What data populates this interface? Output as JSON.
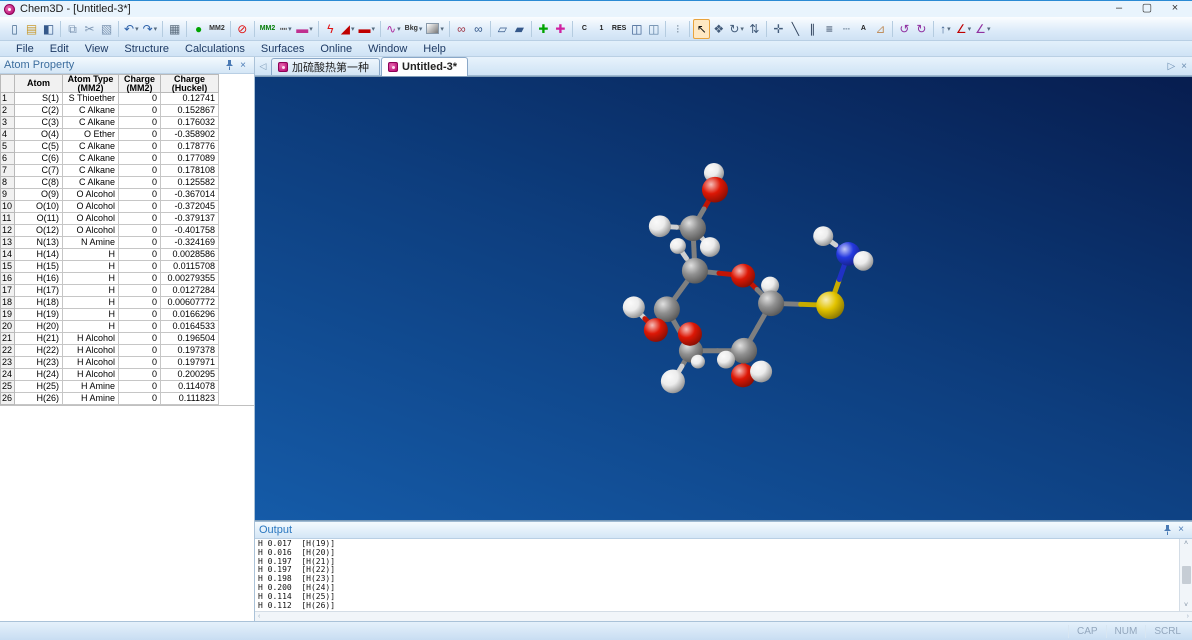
{
  "window": {
    "title": "Chem3D - [Untitled-3*]",
    "controls": {
      "minimize": "–",
      "maximize": "▢",
      "close": "×"
    }
  },
  "menu_bar": {
    "items": [
      "File",
      "Edit",
      "View",
      "Structure",
      "Calculations",
      "Surfaces",
      "Online",
      "Window",
      "Help"
    ]
  },
  "toolbar": {
    "items": [
      {
        "name": "new-document",
        "glyph": "▯",
        "color": "#44688e"
      },
      {
        "name": "open-folder",
        "glyph": "▤",
        "color": "#c89a2e"
      },
      {
        "name": "save",
        "glyph": "◧",
        "color": "#35588a"
      },
      {
        "sep": true
      },
      {
        "name": "copy",
        "glyph": "⧉",
        "color": "#7b93b0"
      },
      {
        "name": "cut",
        "glyph": "✂",
        "color": "#7b93b0"
      },
      {
        "name": "paste",
        "glyph": "▧",
        "color": "#7b93b0"
      },
      {
        "sep": true
      },
      {
        "name": "undo",
        "glyph": "↶",
        "color": "#2b5fa8",
        "caret": true
      },
      {
        "name": "redo",
        "glyph": "↷",
        "color": "#2b5fa8",
        "caret": true
      },
      {
        "sep": true
      },
      {
        "name": "print",
        "glyph": "▦",
        "color": "#5a6b7c"
      },
      {
        "sep": true
      },
      {
        "name": "run-job",
        "glyph": "●",
        "color": "#00a400"
      },
      {
        "name": "mm2-minimize",
        "glyph": "MM2",
        "color": "#333333",
        "text": true
      },
      {
        "sep": true
      },
      {
        "name": "stop-calculation",
        "glyph": "⊘",
        "color": "#e01010"
      },
      {
        "sep": true
      },
      {
        "name": "mm2-dynamics",
        "glyph": "MM2",
        "color": "#067d06",
        "text": true
      },
      {
        "name": "measurement-tool",
        "glyph": "┉",
        "color": "#555555",
        "caret": true
      },
      {
        "name": "rectangle-tool",
        "glyph": "▬",
        "color": "#c03090",
        "caret": true
      },
      {
        "sep": true
      },
      {
        "name": "minimize-energy",
        "glyph": "ϟ",
        "color": "#e01010"
      },
      {
        "name": "bond-wedge",
        "glyph": "◢",
        "color": "#c00000",
        "caret": true
      },
      {
        "name": "bond-length",
        "glyph": "▬",
        "color": "#c00000",
        "caret": true
      },
      {
        "sep": true
      },
      {
        "name": "structure-probe",
        "glyph": "∿",
        "color": "#b030a0",
        "caret": true
      },
      {
        "name": "background-style",
        "glyph": "Bkg",
        "color": "#333333",
        "text": true,
        "caret": true
      },
      {
        "name": "background-swatch",
        "swatch": true,
        "caret": true
      },
      {
        "sep": true
      },
      {
        "name": "stereo-glasses",
        "glyph": "∞",
        "color": "#a03545"
      },
      {
        "name": "stereo-view",
        "glyph": "∞",
        "color": "#35588a"
      },
      {
        "sep": true
      },
      {
        "name": "perspective-box",
        "glyph": "▱",
        "color": "#35588a"
      },
      {
        "name": "depth-fade",
        "glyph": "▰",
        "color": "#35588a"
      },
      {
        "sep": true
      },
      {
        "name": "add-hydrogens",
        "glyph": "✚",
        "color": "#00a400"
      },
      {
        "name": "remove-hydrogens",
        "glyph": "✚",
        "color": "#d020a0"
      },
      {
        "sep": true
      },
      {
        "name": "carbon-labels",
        "glyph": "C",
        "color": "#222222",
        "text": true
      },
      {
        "name": "atom-numbers",
        "glyph": "1",
        "color": "#222222",
        "text": true
      },
      {
        "name": "residue-labels",
        "glyph": "RES",
        "color": "#222222",
        "text": true
      },
      {
        "name": "model-display",
        "glyph": "◫",
        "color": "#35588a"
      },
      {
        "name": "model-playback",
        "glyph": "◫",
        "color": "#5a7da0"
      },
      {
        "sep": true
      },
      {
        "name": "overlay-dots",
        "glyph": "⁝",
        "color": "#8899aa"
      },
      {
        "sep": true
      },
      {
        "name": "select-tool",
        "glyph": "↖",
        "color": "#111111",
        "active": true
      },
      {
        "name": "pan-tool",
        "glyph": "❖",
        "color": "#445c7a"
      },
      {
        "name": "orbit-tool",
        "glyph": "↻",
        "color": "#445c7a",
        "caret": true
      },
      {
        "name": "zoom-tool",
        "glyph": "⇅",
        "color": "#445c7a"
      },
      {
        "sep": true
      },
      {
        "name": "translate-tool",
        "glyph": "✛",
        "color": "#445c7a"
      },
      {
        "name": "bond-single-tool",
        "glyph": "╲",
        "color": "#30425c"
      },
      {
        "name": "bond-double-tool",
        "glyph": "∥",
        "color": "#30425c"
      },
      {
        "name": "bond-multiple-tool",
        "glyph": "≡",
        "color": "#30425c"
      },
      {
        "name": "bond-dashed-tool",
        "glyph": "┄",
        "color": "#6b7f94"
      },
      {
        "name": "text-tool",
        "glyph": "A",
        "color": "#222222",
        "text": true
      },
      {
        "name": "eraser-tool",
        "glyph": "⊿",
        "color": "#c09060"
      },
      {
        "sep": true
      },
      {
        "name": "rotate-bond-left",
        "glyph": "↺",
        "color": "#9030a0"
      },
      {
        "name": "rotate-bond-right",
        "glyph": "↻",
        "color": "#9030a0"
      },
      {
        "sep": true
      },
      {
        "name": "reaction-arrow",
        "glyph": "↑",
        "color": "#35588a",
        "caret": true
      },
      {
        "name": "dihedral-driver",
        "glyph": "∠",
        "color": "#c00000",
        "caret": true
      },
      {
        "name": "angle-driver",
        "glyph": "∠",
        "color": "#9030a0",
        "caret": true
      }
    ]
  },
  "atom_panel": {
    "title": "Atom Property",
    "columns": [
      "Atom",
      "Atom Type\n(MM2)",
      "Charge (MM2)",
      "Charge\n(Huckel)"
    ],
    "rows": [
      [
        "1",
        "S(1)",
        "S Thioether",
        "0",
        "0.12741"
      ],
      [
        "2",
        "C(2)",
        "C Alkane",
        "0",
        "0.152867"
      ],
      [
        "3",
        "C(3)",
        "C Alkane",
        "0",
        "0.176032"
      ],
      [
        "4",
        "O(4)",
        "O Ether",
        "0",
        "-0.358902"
      ],
      [
        "5",
        "C(5)",
        "C Alkane",
        "0",
        "0.178776"
      ],
      [
        "6",
        "C(6)",
        "C Alkane",
        "0",
        "0.177089"
      ],
      [
        "7",
        "C(7)",
        "C Alkane",
        "0",
        "0.178108"
      ],
      [
        "8",
        "C(8)",
        "C Alkane",
        "0",
        "0.125582"
      ],
      [
        "9",
        "O(9)",
        "O Alcohol",
        "0",
        "-0.367014"
      ],
      [
        "10",
        "O(10)",
        "O Alcohol",
        "0",
        "-0.372045"
      ],
      [
        "11",
        "O(11)",
        "O Alcohol",
        "0",
        "-0.379137"
      ],
      [
        "12",
        "O(12)",
        "O Alcohol",
        "0",
        "-0.401758"
      ],
      [
        "13",
        "N(13)",
        "N Amine",
        "0",
        "-0.324169"
      ],
      [
        "14",
        "H(14)",
        "H",
        "0",
        "0.0028586"
      ],
      [
        "15",
        "H(15)",
        "H",
        "0",
        "0.0115708"
      ],
      [
        "16",
        "H(16)",
        "H",
        "0",
        "0.00279355"
      ],
      [
        "17",
        "H(17)",
        "H",
        "0",
        "0.0127284"
      ],
      [
        "18",
        "H(18)",
        "H",
        "0",
        "0.00607772"
      ],
      [
        "19",
        "H(19)",
        "H",
        "0",
        "0.0166296"
      ],
      [
        "20",
        "H(20)",
        "H",
        "0",
        "0.0164533"
      ],
      [
        "21",
        "H(21)",
        "H Alcohol",
        "0",
        "0.196504"
      ],
      [
        "22",
        "H(22)",
        "H Alcohol",
        "0",
        "0.197378"
      ],
      [
        "23",
        "H(23)",
        "H Alcohol",
        "0",
        "0.197971"
      ],
      [
        "24",
        "H(24)",
        "H Alcohol",
        "0",
        "0.200295"
      ],
      [
        "25",
        "H(25)",
        "H Amine",
        "0",
        "0.114078"
      ],
      [
        "26",
        "H(26)",
        "H Amine",
        "0",
        "0.111823"
      ]
    ]
  },
  "tab_bar": {
    "scroll_left": "◁",
    "scroll_right": "▷",
    "close": "×",
    "tabs": [
      {
        "label": "加硫酸热第一种",
        "active": false
      },
      {
        "label": "Untitled-3*",
        "active": true
      }
    ]
  },
  "viewport": {
    "background": {
      "dark": "#071d4f",
      "mid": "#0d3d7d",
      "light": "#155ba8"
    },
    "element_colors": {
      "C": "#909090",
      "H": "#ececec",
      "O": "#dd1705",
      "N": "#2438e0",
      "S": "#e3c400"
    },
    "molecule": {
      "atoms": [
        [
          "H",
          458,
          97,
          10
        ],
        [
          "O",
          459,
          114,
          13
        ],
        [
          "C",
          437,
          153,
          13
        ],
        [
          "H",
          404,
          151,
          11
        ],
        [
          "H",
          422,
          171,
          8
        ],
        [
          "H",
          454,
          172,
          10
        ],
        [
          "C",
          439,
          196,
          13
        ],
        [
          "O",
          487,
          201,
          12
        ],
        [
          "H",
          514,
          211,
          9
        ],
        [
          "C",
          515,
          229,
          13
        ],
        [
          "S",
          574,
          231,
          14
        ],
        [
          "N",
          592,
          179,
          12
        ],
        [
          "H",
          567,
          161,
          10
        ],
        [
          "H",
          607,
          186,
          10
        ],
        [
          "C",
          411,
          235,
          13
        ],
        [
          "H",
          378,
          233,
          11
        ],
        [
          "O",
          400,
          256,
          12
        ],
        [
          "C",
          435,
          277,
          12
        ],
        [
          "O",
          434,
          260,
          12
        ],
        [
          "H",
          442,
          288,
          7
        ],
        [
          "H",
          417,
          308,
          12
        ],
        [
          "C",
          488,
          277,
          13
        ],
        [
          "H",
          470,
          286,
          9
        ],
        [
          "O",
          487,
          302,
          12
        ],
        [
          "H",
          505,
          298,
          11
        ]
      ],
      "bonds": [
        [
          0,
          1
        ],
        [
          1,
          2
        ],
        [
          2,
          3
        ],
        [
          2,
          5
        ],
        [
          2,
          6
        ],
        [
          6,
          4
        ],
        [
          6,
          7
        ],
        [
          7,
          9
        ],
        [
          8,
          9
        ],
        [
          9,
          10
        ],
        [
          10,
          11
        ],
        [
          11,
          12
        ],
        [
          11,
          13
        ],
        [
          6,
          14
        ],
        [
          14,
          16
        ],
        [
          15,
          16
        ],
        [
          14,
          17
        ],
        [
          17,
          18
        ],
        [
          17,
          19
        ],
        [
          17,
          20
        ],
        [
          17,
          21
        ],
        [
          21,
          22
        ],
        [
          21,
          23
        ],
        [
          23,
          24
        ],
        [
          21,
          9
        ]
      ]
    }
  },
  "output_panel": {
    "title": "Output",
    "lines": [
      "H 0.017  [H(19)]",
      "H 0.016  [H(20)]",
      "H 0.197  [H(21)]",
      "H 0.197  [H(22)]",
      "H 0.198  [H(23)]",
      "H 0.200  [H(24)]",
      "H 0.114  [H(25)]",
      "H 0.112  [H(26)]"
    ]
  },
  "status_bar": {
    "indicators": [
      "CAP",
      "NUM",
      "SCRL"
    ]
  }
}
